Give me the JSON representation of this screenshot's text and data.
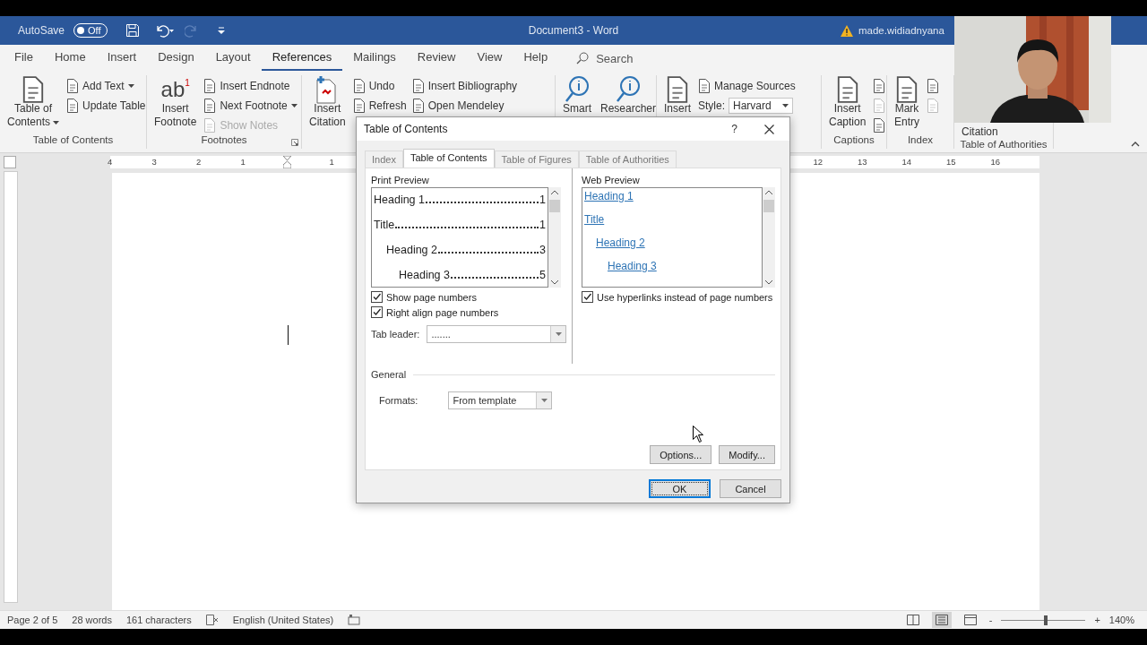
{
  "title_bar": {
    "autosave_label": "AutoSave",
    "autosave_toggle": {
      "label": "Off",
      "on": false
    },
    "title": "Document3 - Word",
    "account": "made.widiadnyana"
  },
  "menu_tabs": [
    {
      "label": "File",
      "selected": false
    },
    {
      "label": "Home",
      "selected": false
    },
    {
      "label": "Insert",
      "selected": false
    },
    {
      "label": "Design",
      "selected": false
    },
    {
      "label": "Layout",
      "selected": false
    },
    {
      "label": "References",
      "selected": true
    },
    {
      "label": "Mailings",
      "selected": false
    },
    {
      "label": "Review",
      "selected": false
    },
    {
      "label": "View",
      "selected": false
    },
    {
      "label": "Help",
      "selected": false
    }
  ],
  "search": {
    "label": "Search"
  },
  "ribbon_groups": [
    {
      "label": "Table of Contents",
      "items": [
        {
          "kind": "large",
          "lines": [
            "Table of",
            "Contents"
          ],
          "dropdown": true
        },
        {
          "kind": "stack",
          "items": [
            {
              "kind": "small",
              "label": "Add Text",
              "dropdown": true,
              "disabled": false
            },
            {
              "kind": "small",
              "label": "Update Table",
              "dropdown": false,
              "disabled": false
            }
          ]
        }
      ]
    },
    {
      "label": "Footnotes",
      "launcher": true,
      "items": [
        {
          "kind": "large",
          "glyph": "ab",
          "glyph_mark": "1",
          "lines": [
            "Insert",
            "Footnote"
          ],
          "dropdown": false
        },
        {
          "kind": "stack",
          "items": [
            {
              "kind": "small",
              "label": "Insert Endnote",
              "dropdown": false,
              "disabled": false
            },
            {
              "kind": "small",
              "label": "Next Footnote",
              "dropdown": true,
              "disabled": false
            },
            {
              "kind": "small",
              "label": "Show Notes",
              "dropdown": false,
              "disabled": true
            }
          ]
        }
      ]
    },
    {
      "items": [
        {
          "kind": "large",
          "lines": [
            "Insert",
            "Citation"
          ],
          "dropdown": false
        },
        {
          "kind": "stack",
          "items": [
            {
              "kind": "small",
              "label": "Undo",
              "dropdown": false,
              "disabled": false
            },
            {
              "kind": "small",
              "label": "Refresh",
              "dropdown": false,
              "disabled": false
            }
          ]
        },
        {
          "kind": "stack",
          "items": [
            {
              "kind": "small",
              "label": "Insert Bibliography",
              "dropdown": false,
              "disabled": false
            },
            {
              "kind": "small",
              "label": "Open Mendeley",
              "dropdown": false,
              "disabled": false
            }
          ]
        }
      ]
    },
    {
      "items": [
        {
          "kind": "large",
          "lines": [
            "Smart"
          ],
          "dropdown": false
        },
        {
          "kind": "large",
          "lines": [
            "Researcher"
          ],
          "dropdown": false
        }
      ]
    },
    {
      "items": [
        {
          "kind": "large",
          "lines": [
            "Insert"
          ],
          "dropdown": false
        },
        {
          "kind": "stack",
          "items": [
            {
              "kind": "small",
              "label": "Manage Sources",
              "dropdown": false,
              "disabled": false
            },
            {
              "kind": "select",
              "label": "Style:",
              "value": "Harvard"
            }
          ]
        }
      ]
    },
    {
      "label": "Captions",
      "items": [
        {
          "kind": "large",
          "lines": [
            "Insert",
            "Caption"
          ],
          "dropdown": false
        },
        {
          "kind": "stack",
          "items": [
            {
              "kind": "icon",
              "disabled": false
            },
            {
              "kind": "icon",
              "disabled": true
            },
            {
              "kind": "icon",
              "disabled": false
            }
          ]
        }
      ]
    },
    {
      "label": "Index",
      "items": [
        {
          "kind": "large",
          "lines": [
            "Mark",
            "Entry"
          ],
          "dropdown": false
        },
        {
          "kind": "stack",
          "items": [
            {
              "kind": "icon",
              "disabled": false
            },
            {
              "kind": "icon",
              "disabled": true
            }
          ]
        }
      ]
    },
    {
      "label": "Table of Authorities",
      "items": [
        {
          "kind": "label_only",
          "lines": [
            "Citation"
          ],
          "dropdown": false
        }
      ]
    }
  ],
  "ruler": {
    "left_marks": [
      "4",
      "3",
      "2",
      "1"
    ],
    "after_marks": [
      "1"
    ],
    "right_marks": [
      "12",
      "13",
      "14",
      "15",
      "16"
    ]
  },
  "dialog": {
    "title": "Table of Contents",
    "help": "?",
    "tabs": [
      {
        "label": "Index",
        "selected": false
      },
      {
        "label": "Table of Contents",
        "selected": true
      },
      {
        "label": "Table of Figures",
        "selected": false
      },
      {
        "label": "Table of Authorities",
        "selected": false
      }
    ],
    "print_preview": {
      "label": "Print Preview",
      "entries": [
        {
          "text": "Heading 1",
          "page": "1"
        },
        {
          "text": "Title",
          "page": "1",
          "children": [
            {
              "text": "Heading 2",
              "page": "3",
              "children": [
                {
                  "text": "Heading 3",
                  "page": "5"
                }
              ]
            }
          ]
        }
      ]
    },
    "show_page_numbers": {
      "label": "Show page numbers",
      "checked": true
    },
    "right_align": {
      "label": "Right align page numbers",
      "checked": true
    },
    "tab_leader": {
      "label": "Tab leader:",
      "value": "......."
    },
    "web_preview": {
      "label": "Web Preview",
      "entries": [
        {
          "text": "Heading 1"
        },
        {
          "text": "Title",
          "children": [
            {
              "text": "Heading 2",
              "children": [
                {
                  "text": "Heading 3"
                }
              ]
            }
          ]
        }
      ]
    },
    "use_hyperlinks": {
      "label": "Use hyperlinks instead of page numbers",
      "checked": true
    },
    "general": {
      "label": "General",
      "formats": {
        "label": "Formats:",
        "value": "From template"
      }
    },
    "buttons": [
      {
        "label": "Options..."
      },
      {
        "label": "Modify..."
      }
    ],
    "footer_buttons": [
      {
        "label": "OK",
        "default": true
      },
      {
        "label": "Cancel",
        "default": false
      }
    ]
  },
  "status_bar": {
    "page": "Page 2 of 5",
    "words": "28 words",
    "characters": "161 characters",
    "language": "English (United States)",
    "views": [
      {
        "selected": false
      },
      {
        "selected": true
      },
      {
        "selected": false
      }
    ],
    "zoom": {
      "minus": "-",
      "plus": "+",
      "level": 0.53,
      "reading": "140%"
    }
  }
}
